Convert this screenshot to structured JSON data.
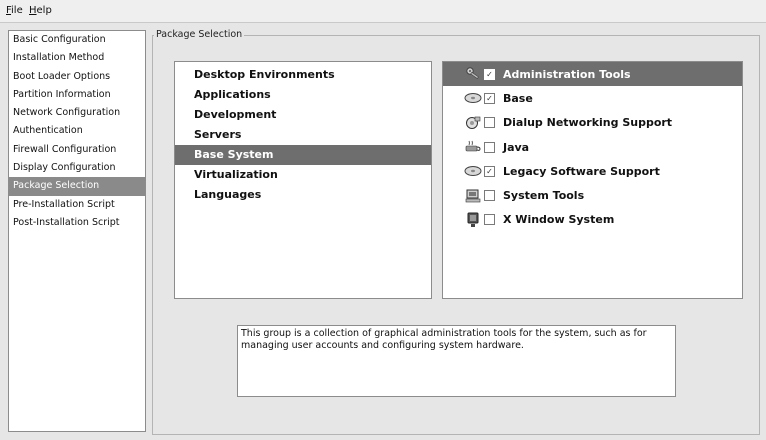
{
  "menu": {
    "file": {
      "mnemonic": "F",
      "rest": "ile"
    },
    "help": {
      "mnemonic": "H",
      "rest": "elp"
    }
  },
  "sidebar": {
    "items": [
      {
        "label": "Basic Configuration"
      },
      {
        "label": "Installation Method"
      },
      {
        "label": "Boot Loader Options"
      },
      {
        "label": "Partition Information"
      },
      {
        "label": "Network Configuration"
      },
      {
        "label": "Authentication"
      },
      {
        "label": "Firewall Configuration"
      },
      {
        "label": "Display Configuration"
      },
      {
        "label": "Package Selection",
        "selected": true
      },
      {
        "label": "Pre-Installation Script"
      },
      {
        "label": "Post-Installation Script"
      }
    ]
  },
  "panel": {
    "title": "Package Selection"
  },
  "categories": {
    "items": [
      {
        "label": "Desktop Environments"
      },
      {
        "label": "Applications"
      },
      {
        "label": "Development"
      },
      {
        "label": "Servers"
      },
      {
        "label": "Base System",
        "selected": true
      },
      {
        "label": "Virtualization"
      },
      {
        "label": "Languages"
      }
    ]
  },
  "packages": {
    "items": [
      {
        "label": "Administration Tools",
        "checked": true,
        "icon": "keys-icon",
        "selected": true
      },
      {
        "label": "Base",
        "checked": true,
        "icon": "disk-icon"
      },
      {
        "label": "Dialup Networking Support",
        "checked": false,
        "icon": "dialup-icon"
      },
      {
        "label": "Java",
        "checked": false,
        "icon": "java-icon"
      },
      {
        "label": "Legacy Software Support",
        "checked": true,
        "icon": "disk-icon"
      },
      {
        "label": "System Tools",
        "checked": false,
        "icon": "system-tools-icon"
      },
      {
        "label": "X Window System",
        "checked": false,
        "icon": "monitor-icon"
      }
    ]
  },
  "description": {
    "text": "This group is a collection of graphical administration tools for the system, such as for managing user accounts and configuring system hardware."
  }
}
